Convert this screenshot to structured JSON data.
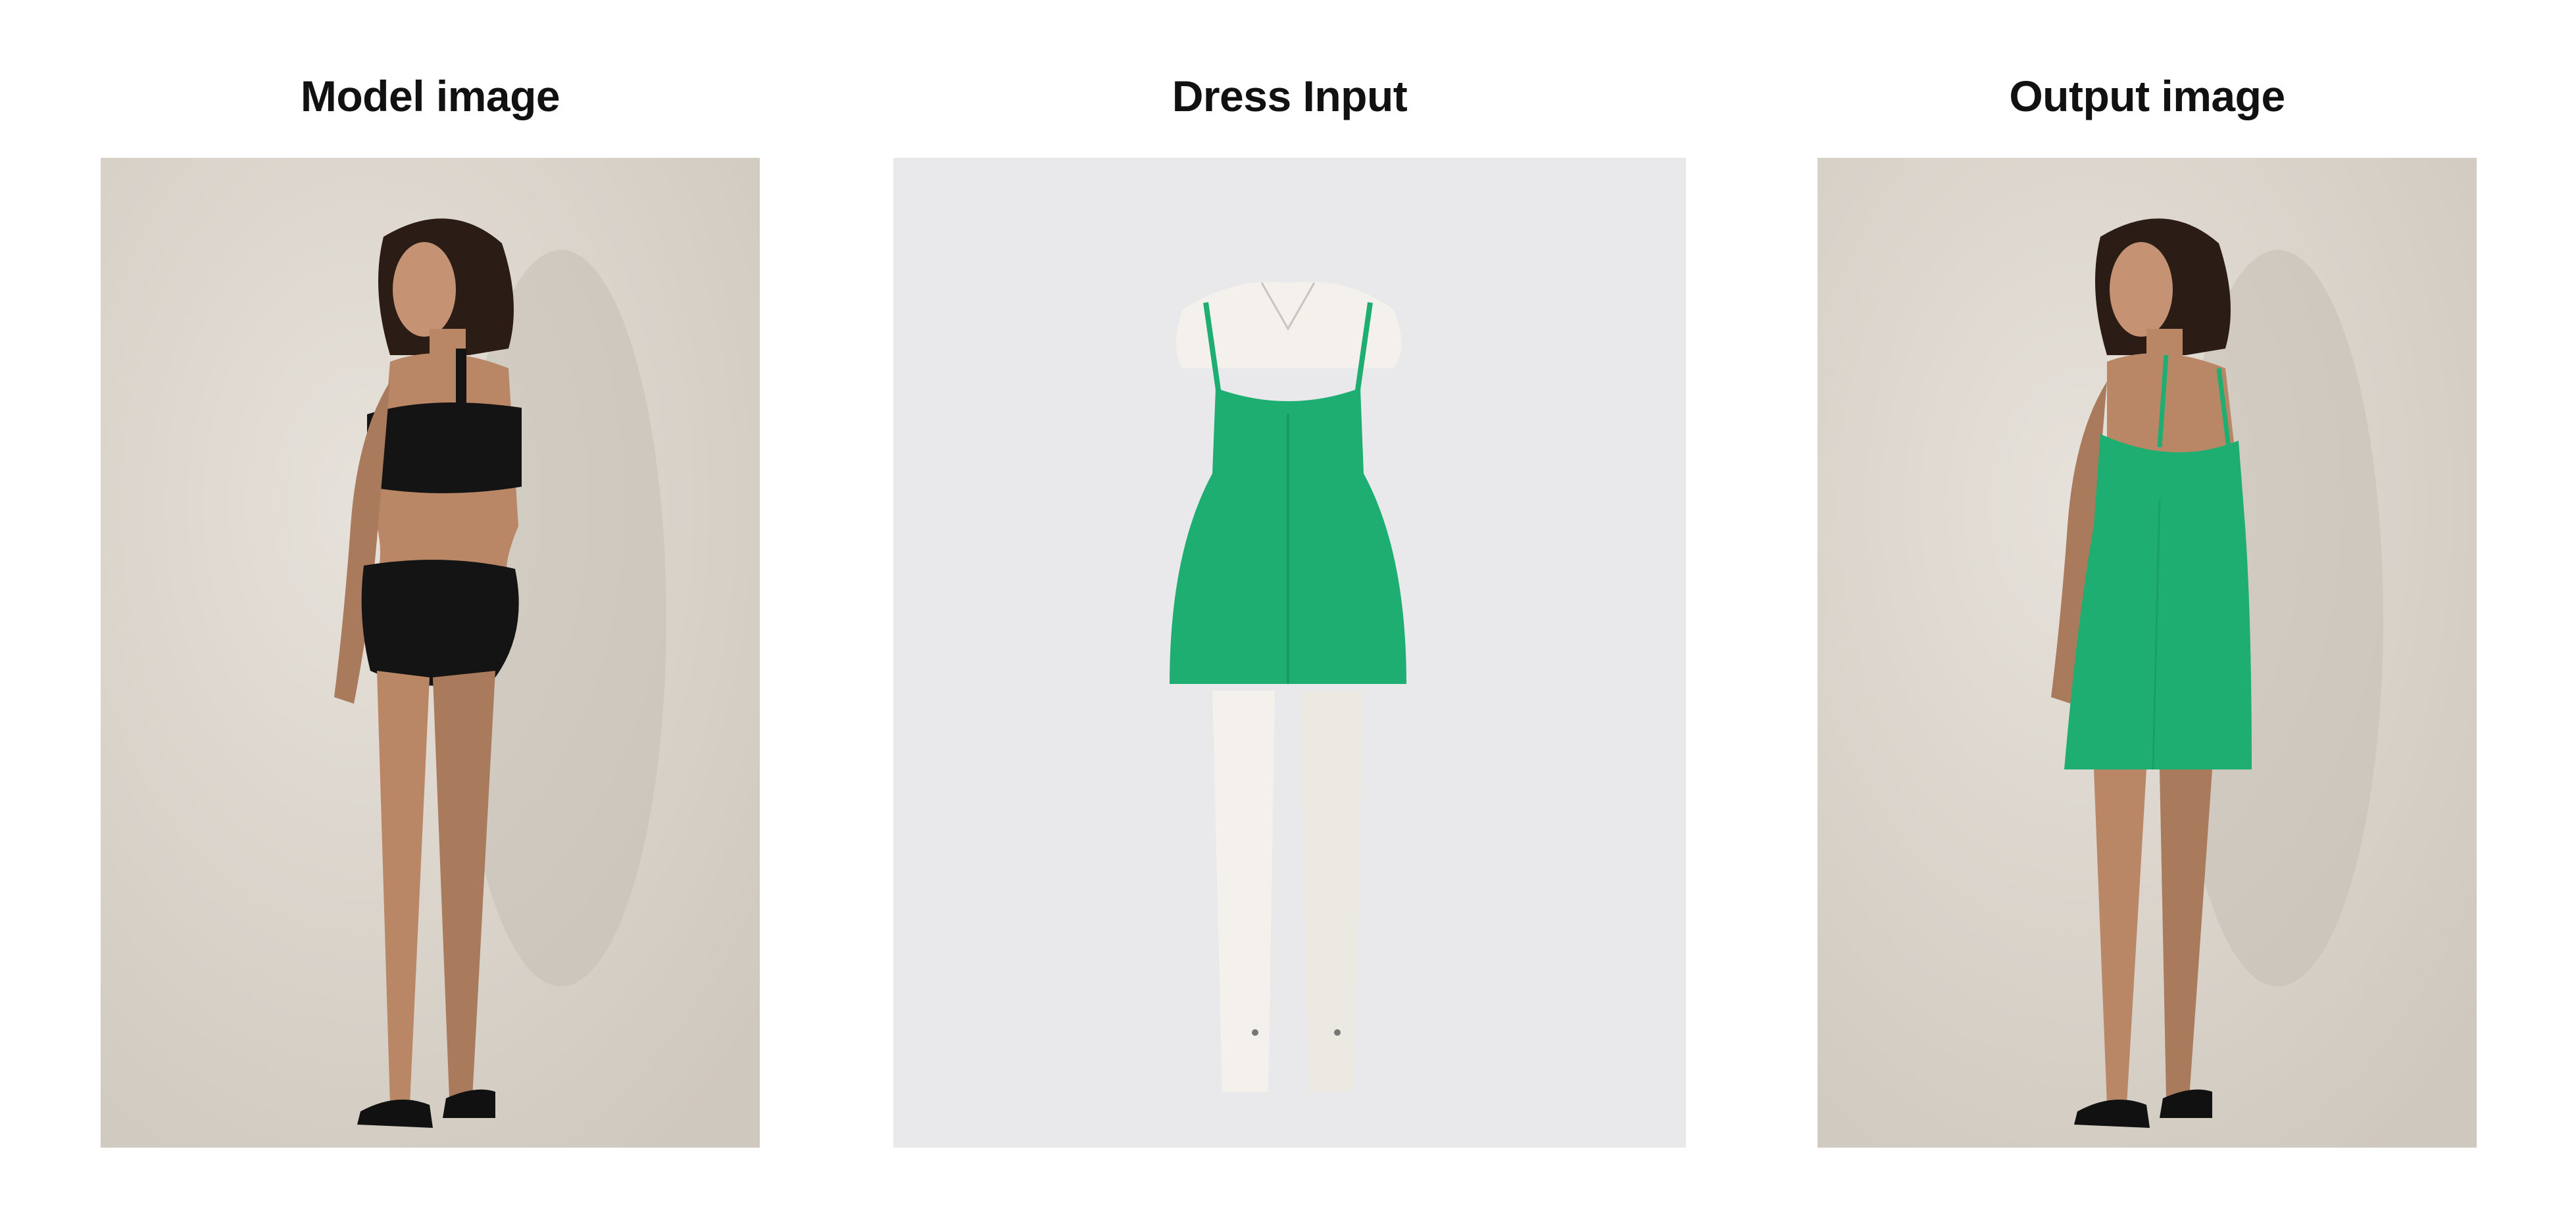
{
  "panels": [
    {
      "title": "Model image",
      "image": "model-photo"
    },
    {
      "title": "Dress Input",
      "image": "dress-on-mannequin-photo"
    },
    {
      "title": "Output image",
      "image": "model-wearing-dress-photo"
    }
  ],
  "colors": {
    "background": "#ffffff",
    "studio_backdrop": "#d9d3cb",
    "mannequin_backdrop": "#e9e9eb",
    "dress_green": "#1fae72",
    "underwear_black": "#141414",
    "skin": "#b98766",
    "mannequin_white": "#f4f1ec"
  }
}
